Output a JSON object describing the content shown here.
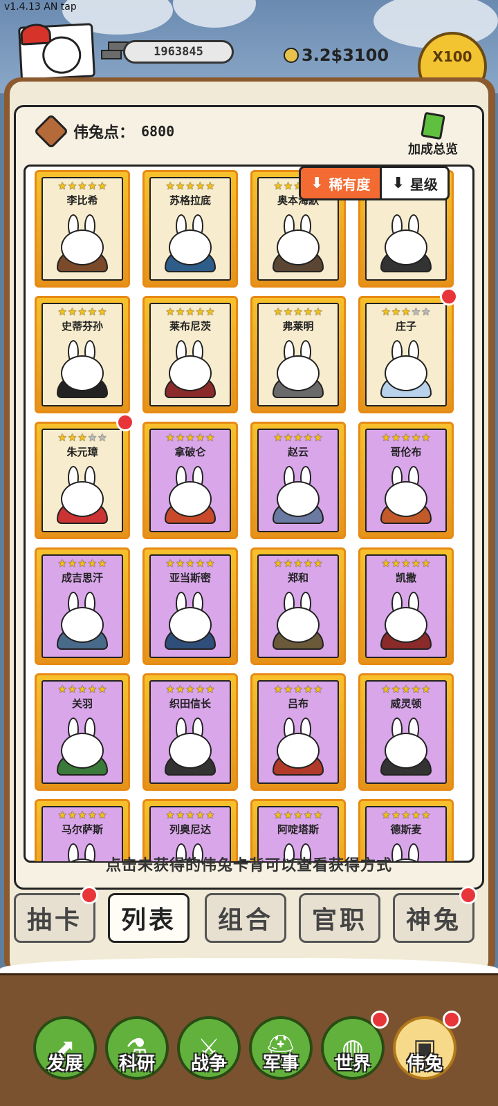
{
  "version": "v1.4.13 AN tap",
  "hud": {
    "money": "1963845",
    "coins": "3.2$3100",
    "multiplier": "X100"
  },
  "points": {
    "label": "伟兔点：",
    "value": "6800"
  },
  "bonus_label": "加成总览",
  "sort": {
    "rarity": "稀有度",
    "star": "星级"
  },
  "cards": [
    {
      "name": "李比希",
      "stars": 5,
      "rarity": "gold",
      "dot": false
    },
    {
      "name": "苏格拉底",
      "stars": 5,
      "rarity": "gold",
      "dot": false
    },
    {
      "name": "奥本海默",
      "stars": 5,
      "rarity": "gold",
      "dot": false
    },
    {
      "name": "",
      "stars": 5,
      "rarity": "gold",
      "dot": false
    },
    {
      "name": "史蒂芬孙",
      "stars": 5,
      "rarity": "gold",
      "dot": false
    },
    {
      "name": "莱布尼茨",
      "stars": 5,
      "rarity": "gold",
      "dot": false
    },
    {
      "name": "弗莱明",
      "stars": 5,
      "rarity": "gold",
      "dot": false
    },
    {
      "name": "庄子",
      "stars": 3,
      "rarity": "gold",
      "dot": true
    },
    {
      "name": "朱元璋",
      "stars": 3,
      "rarity": "gold",
      "dot": true
    },
    {
      "name": "拿破仑",
      "stars": 5,
      "rarity": "purple",
      "dot": false
    },
    {
      "name": "赵云",
      "stars": 5,
      "rarity": "purple",
      "dot": false
    },
    {
      "name": "哥伦布",
      "stars": 5,
      "rarity": "purple",
      "dot": false
    },
    {
      "name": "成吉思汗",
      "stars": 5,
      "rarity": "purple",
      "dot": false
    },
    {
      "name": "亚当斯密",
      "stars": 5,
      "rarity": "purple",
      "dot": false
    },
    {
      "name": "郑和",
      "stars": 5,
      "rarity": "purple",
      "dot": false
    },
    {
      "name": "凯撒",
      "stars": 5,
      "rarity": "purple",
      "dot": false
    },
    {
      "name": "关羽",
      "stars": 5,
      "rarity": "purple",
      "dot": false
    },
    {
      "name": "织田信长",
      "stars": 5,
      "rarity": "purple",
      "dot": false
    },
    {
      "name": "吕布",
      "stars": 5,
      "rarity": "purple",
      "dot": false
    },
    {
      "name": "威灵顿",
      "stars": 5,
      "rarity": "purple",
      "dot": false
    },
    {
      "name": "马尔萨斯",
      "stars": 5,
      "rarity": "purple",
      "dot": false
    },
    {
      "name": "列奥尼达",
      "stars": 5,
      "rarity": "purple",
      "dot": false
    },
    {
      "name": "阿啶塔斯",
      "stars": 5,
      "rarity": "purple",
      "dot": false
    },
    {
      "name": "德斯麦",
      "stars": 5,
      "rarity": "purple",
      "dot": false
    }
  ],
  "hint": "点击未获得的伟兔卡背可以查看获得方式",
  "subtabs": [
    {
      "label": "抽卡",
      "active": false,
      "dot": true
    },
    {
      "label": "列表",
      "active": true,
      "dot": false
    },
    {
      "label": "组合",
      "active": false,
      "dot": false
    },
    {
      "label": "官职",
      "active": false,
      "dot": false
    },
    {
      "label": "神兔",
      "active": false,
      "dot": true
    }
  ],
  "nav": [
    {
      "label": "发展",
      "icon": "arrow-up-icon",
      "glyph": "⬈",
      "dot": false,
      "active": false
    },
    {
      "label": "科研",
      "icon": "flask-icon",
      "glyph": "⚗",
      "dot": false,
      "active": false
    },
    {
      "label": "战争",
      "icon": "crossed-swords-icon",
      "glyph": "⚔",
      "dot": false,
      "active": false
    },
    {
      "label": "军事",
      "icon": "helmet-icon",
      "glyph": "⛑",
      "dot": false,
      "active": false
    },
    {
      "label": "世界",
      "icon": "globe-icon",
      "glyph": "◍",
      "dot": true,
      "active": false
    },
    {
      "label": "伟兔",
      "icon": "rabbit-card-icon",
      "glyph": "▣",
      "dot": true,
      "active": true
    }
  ]
}
